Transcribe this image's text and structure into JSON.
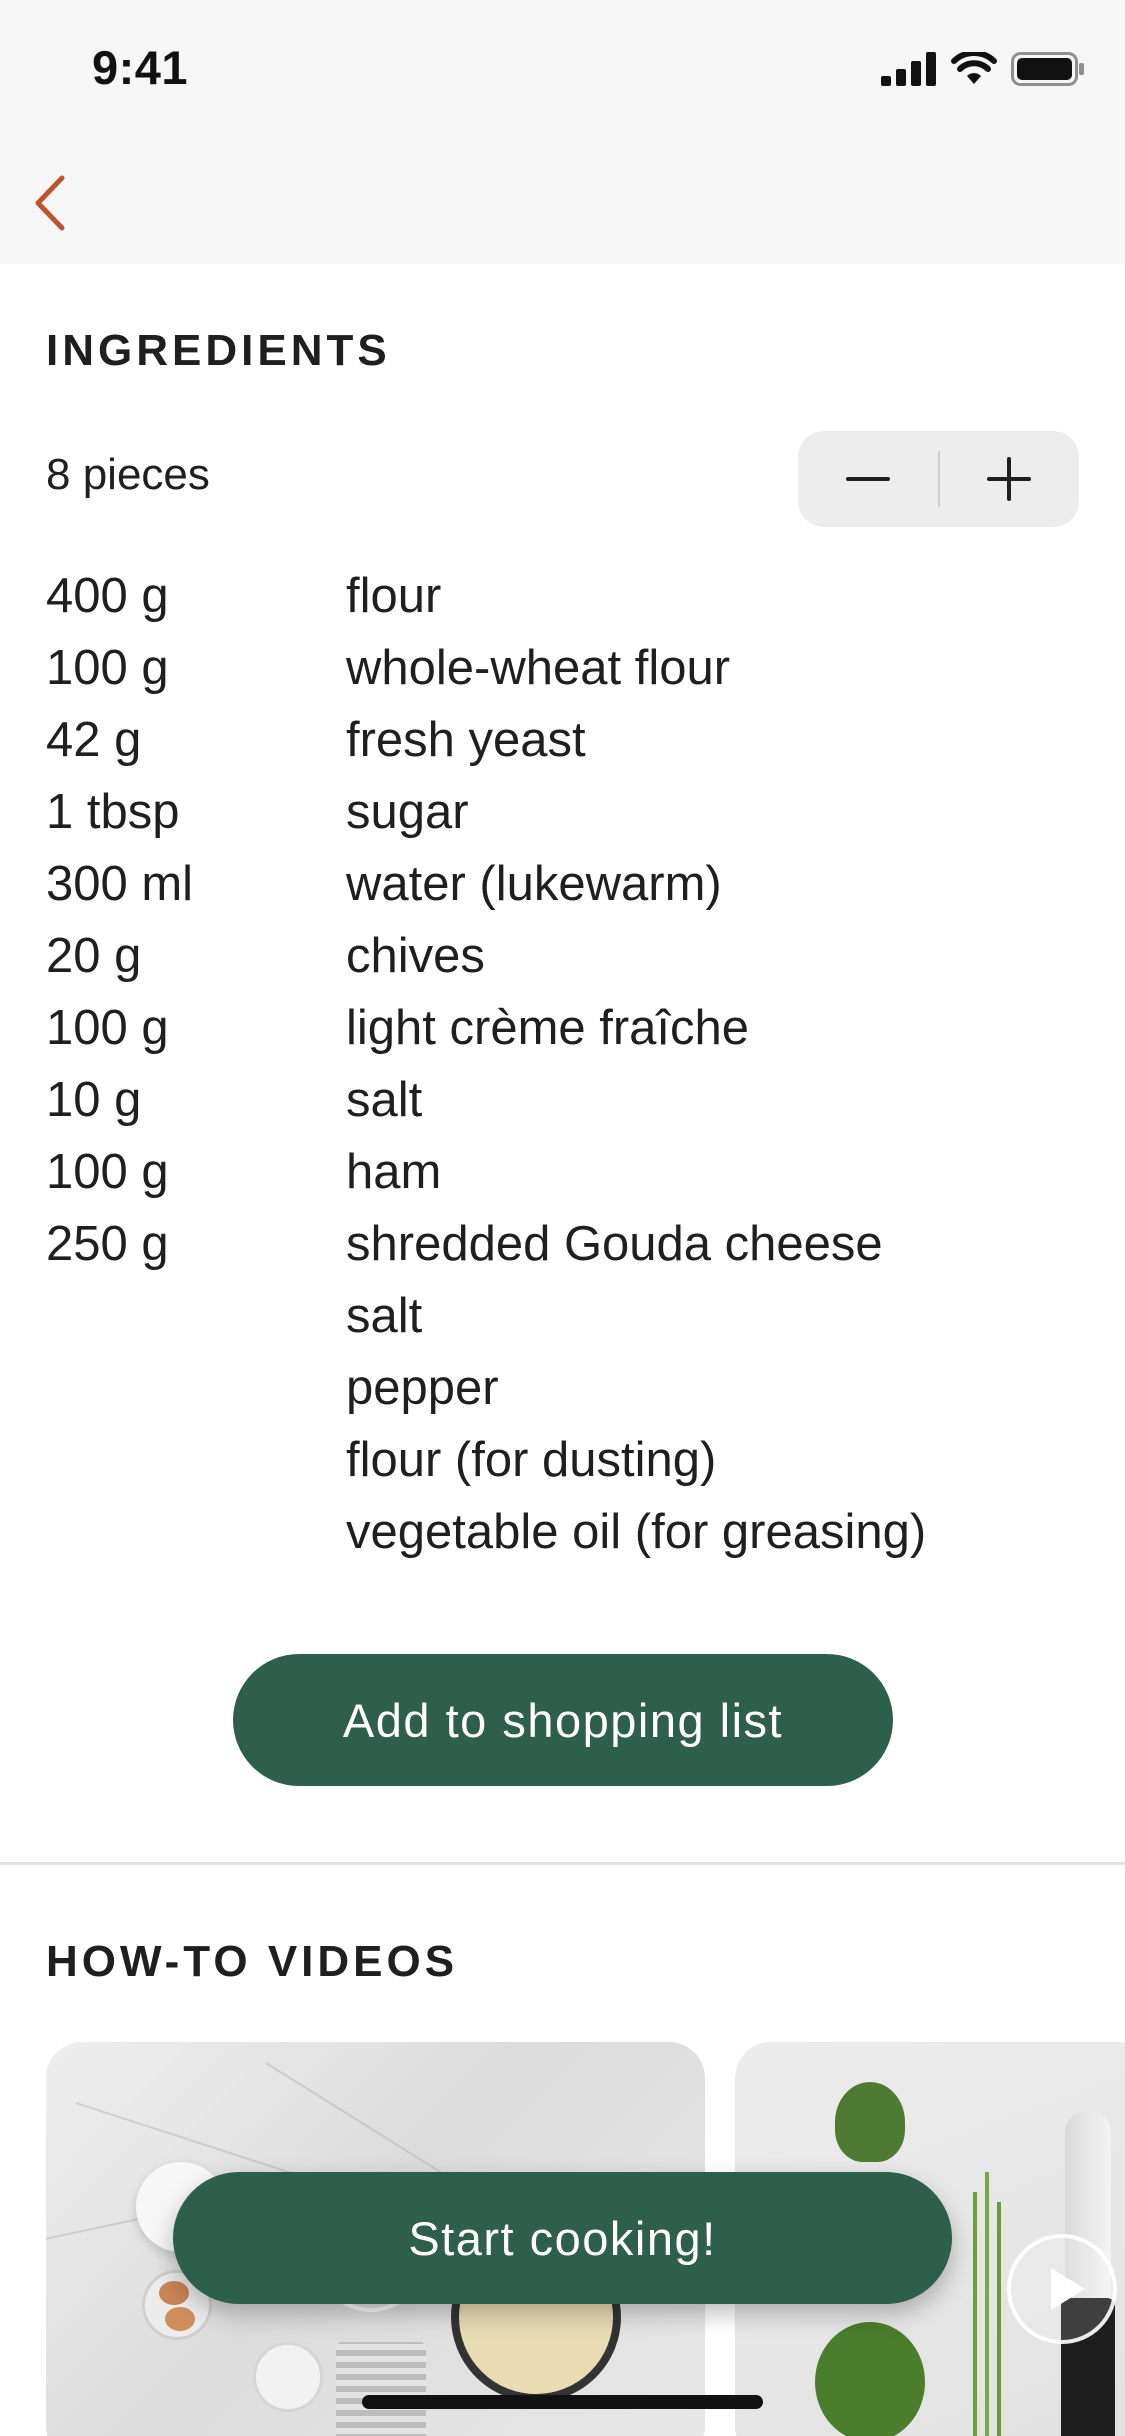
{
  "status_bar": {
    "time": "9:41",
    "icons": [
      "cellular-signal-icon",
      "wifi-icon",
      "battery-icon"
    ]
  },
  "nav": {
    "back_icon": "chevron-left-icon"
  },
  "ingredients": {
    "title": "INGREDIENTS",
    "servings": "8 pieces",
    "stepper": {
      "decrement_icon": "minus-icon",
      "increment_icon": "plus-icon"
    },
    "items": [
      {
        "qty": "400 g",
        "name": "flour"
      },
      {
        "qty": "100 g",
        "name": "whole-wheat flour"
      },
      {
        "qty": "42 g",
        "name": "fresh yeast"
      },
      {
        "qty": "1 tbsp",
        "name": "sugar"
      },
      {
        "qty": "300 ml",
        "name": "water (lukewarm)"
      },
      {
        "qty": "20 g",
        "name": "chives"
      },
      {
        "qty": "100 g",
        "name": "light crème fraîche"
      },
      {
        "qty": "10 g",
        "name": "salt"
      },
      {
        "qty": "100 g",
        "name": "ham"
      },
      {
        "qty": "250 g",
        "name": "shredded Gouda cheese"
      },
      {
        "qty": "",
        "name": "salt"
      },
      {
        "qty": "",
        "name": "pepper"
      },
      {
        "qty": "",
        "name": "flour (for dusting)"
      },
      {
        "qty": "",
        "name": "vegetable oil (for greasing)"
      }
    ],
    "shopping_button": "Add to shopping list"
  },
  "videos": {
    "title": "HOW-TO VIDEOS",
    "play_icon": "play-icon"
  },
  "cook_button": "Start cooking!",
  "colors": {
    "accent": "#2e5e4c",
    "back_chevron": "#c0532f",
    "header_bg": "#f6f6f6"
  }
}
